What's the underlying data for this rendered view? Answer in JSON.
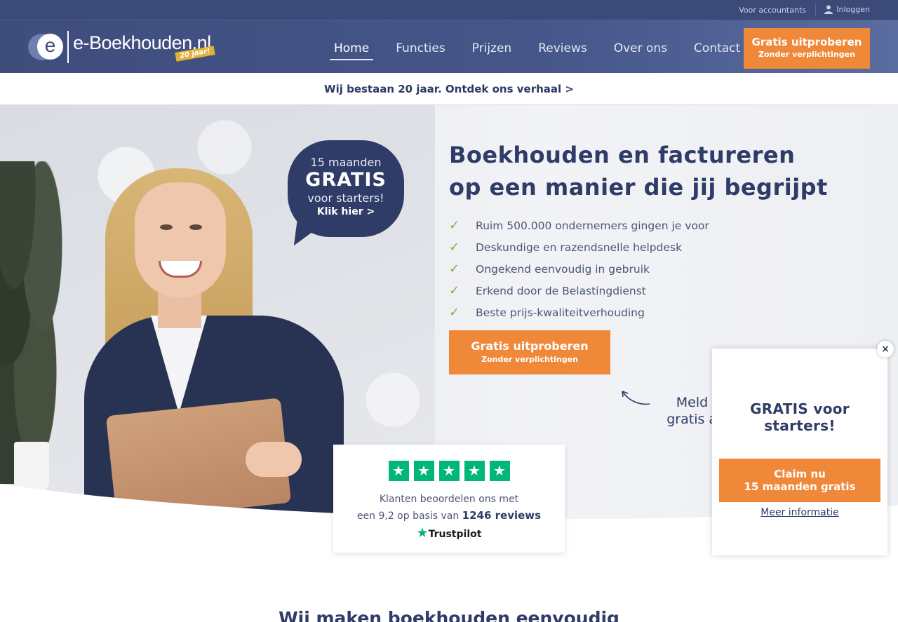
{
  "topbar": {
    "accountants": "Voor accountants",
    "login": "Inloggen"
  },
  "header": {
    "logo_letter": "e",
    "logo_name": "e-Boekhouden.nl",
    "logo_badge": "20 jaar!",
    "nav": [
      "Home",
      "Functies",
      "Prijzen",
      "Reviews",
      "Over ons",
      "Contact"
    ],
    "cta_line1": "Gratis uitproberen",
    "cta_line2": "Zonder verplichtingen"
  },
  "announcement": "Wij bestaan 20 jaar. Ontdek ons verhaal >",
  "hero": {
    "bubble": {
      "line1": "15 maanden",
      "line2": "GRATIS",
      "line3": "voor starters!",
      "link": "Klik hier >"
    },
    "title_line1": "Boekhouden en factureren",
    "title_line2": "op een manier die jij begrijpt",
    "features": [
      "Ruim 500.000 ondernemers gingen je voor",
      "Deskundige en razendsnelle helpdesk",
      "Ongekend eenvoudig in gebruik",
      "Erkend door de Belastingdienst",
      "Beste prijs-kwaliteitverhouding"
    ],
    "cta_line1": "Gratis uitproberen",
    "cta_line2": "Zonder verplichtingen",
    "signup_line1": "Meld je",
    "signup_line2": "gratis aan"
  },
  "trustpilot": {
    "rating_stars": 5,
    "text_line1": "Klanten beoordelen ons met",
    "text_line2_prefix": "een 9,2 op basis van",
    "reviews": "1246 reviews",
    "brand": "Trustpilot"
  },
  "section_title": "Wij maken boekhouden eenvoudig",
  "popup": {
    "title": "GRATIS voor starters!",
    "button_line1": "Claim nu",
    "button_line2": "15 maanden gratis",
    "more": "Meer informatie",
    "close": "×"
  },
  "colors": {
    "navy": "#2f3c68",
    "orange": "#f0883a",
    "green_check": "#7cb342",
    "trustpilot_green": "#00b67a"
  }
}
